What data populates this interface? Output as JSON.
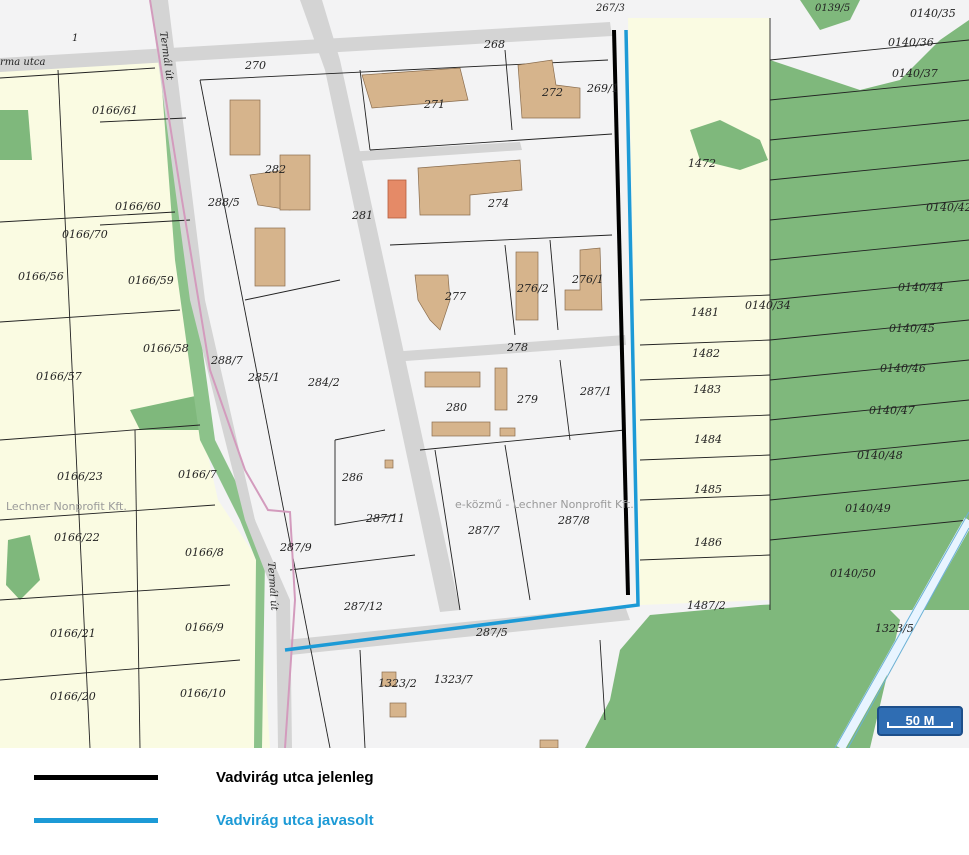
{
  "map": {
    "parcel_labels": [
      "0166/61",
      "0166/60",
      "0166/70",
      "0166/56",
      "0166/59",
      "0166/58",
      "0166/57",
      "0166/23",
      "0166/7",
      "0166/22",
      "0166/8",
      "0166/21",
      "0166/9",
      "0166/20",
      "0166/10",
      "270",
      "268",
      "271",
      "272",
      "269/1",
      "282",
      "288/5",
      "281",
      "274",
      "277",
      "276/2",
      "276/1",
      "278",
      "288/7",
      "285/1",
      "284/2",
      "280",
      "279",
      "287/1",
      "286",
      "287/11",
      "287/9",
      "287/7",
      "287/8",
      "287/12",
      "287/5",
      "1323/2",
      "1323/7",
      "1472",
      "1481",
      "1482",
      "1483",
      "1484",
      "1485",
      "1486",
      "1487/2",
      "0140/34",
      "0140/35",
      "0140/36",
      "0140/37",
      "0140/42",
      "0140/44",
      "0140/45",
      "0140/46",
      "0140/47",
      "0140/48",
      "0140/49",
      "0140/50",
      "1323/5",
      "267/3",
      "0139/5",
      "1"
    ],
    "street_labels": [
      "Termál út",
      "Termál út",
      "rma utca"
    ],
    "watermarks": [
      "Lechner Nonprofit Kft.",
      "e-közmű - Lechner Nonprofit Kft."
    ],
    "colors": {
      "forest": "#7fb87c",
      "agricultural": "#fafbe2",
      "built": "#f3f3f4",
      "road": "#d4d4d4",
      "building": "#d6b48c",
      "current_street": "#000000",
      "proposed_street": "#1c9ad6"
    }
  },
  "scale": {
    "label": "50 M"
  },
  "legend": {
    "items": [
      {
        "label": "Vadvirág utca jelenleg",
        "color": "#000000"
      },
      {
        "label": "Vadvirág utca javasolt",
        "color": "#1c9ad6"
      }
    ]
  }
}
